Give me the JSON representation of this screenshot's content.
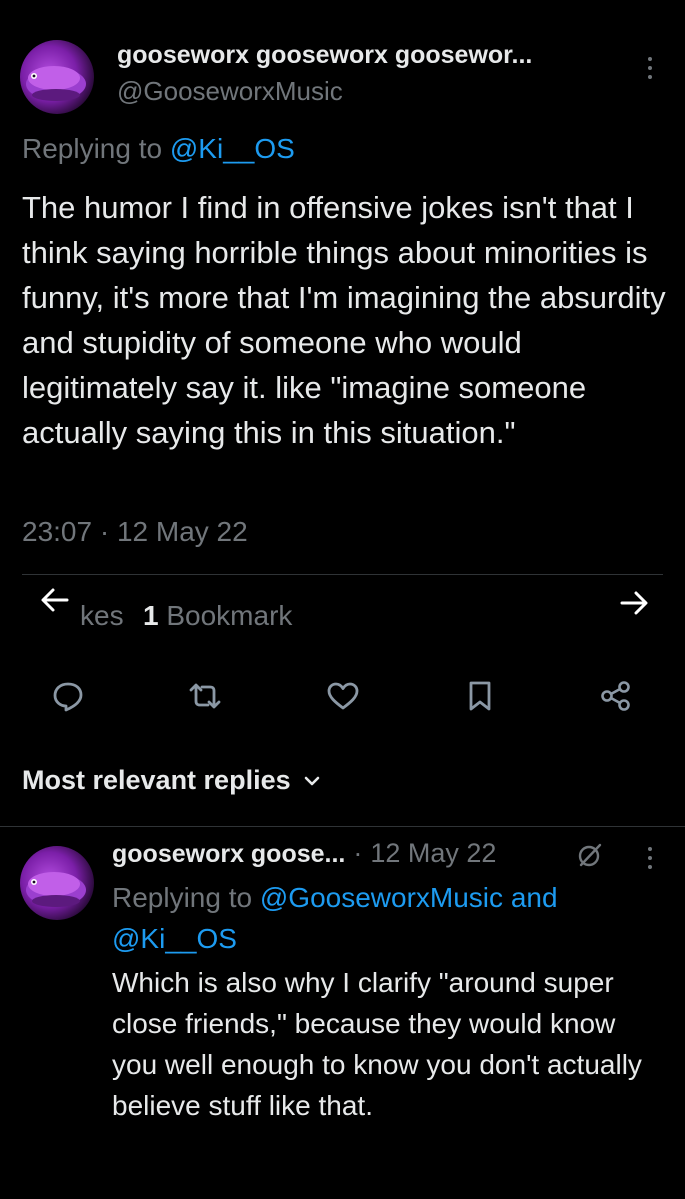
{
  "tweet": {
    "author_name": "gooseworx gooseworx goosewor...",
    "author_handle": "@GooseworxMusic",
    "replying_prefix": "Replying to",
    "replying_to": "@Ki__OS",
    "text": "The humor I find in offensive jokes isn't that I think saying horrible things about minorities is funny, it's more that I'm imagining the absurdity and stupidity of someone who would legitimately say it. like \"imagine someone actually saying this in this situation.\"",
    "timestamp": "23:07 · 12 May 22"
  },
  "stats": {
    "likes_fragment": "kes",
    "bookmark_count": "1",
    "bookmark_label": "Bookmark"
  },
  "actions": [
    "reply-icon",
    "retweet-icon",
    "like-icon",
    "bookmark-icon",
    "share-icon"
  ],
  "replies_sort": {
    "label": "Most relevant replies"
  },
  "reply": {
    "author_name": "gooseworx goose...",
    "separator": "·",
    "date": "12 May 22",
    "replying_prefix": "Replying to",
    "replying_to_1": "@GooseworxMusic",
    "replying_and": "and",
    "replying_to_2": "@Ki__OS",
    "text": "Which is also why I clarify \"around super close friends,\" because they would know you well enough to know you don't actually believe stuff like that."
  },
  "colors": {
    "background": "#000000",
    "text": "#e7e9ea",
    "muted": "#71767b",
    "link": "#1d9bf0",
    "divider": "#2f3336"
  }
}
